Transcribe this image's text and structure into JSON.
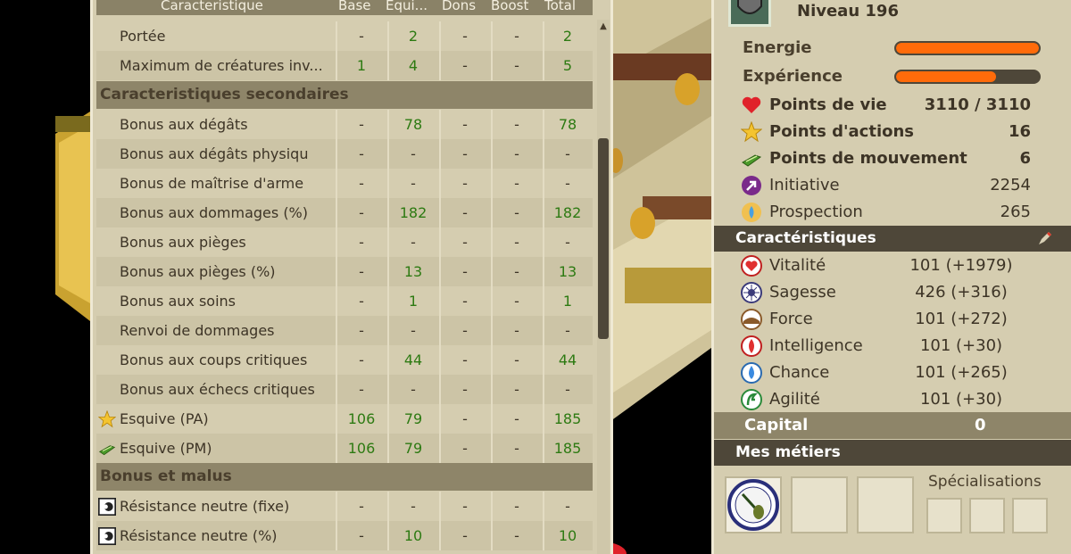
{
  "stats_table": {
    "headers": {
      "name": "Caracteristique",
      "base": "Base",
      "equip": "Equi...",
      "dons": "Dons",
      "boost": "Boost",
      "total": "Total"
    },
    "rows_top": [
      {
        "name": "Portée",
        "base": "-",
        "equip": "2",
        "dons": "-",
        "boost": "-",
        "total": "2"
      },
      {
        "name": "Maximum de créatures inv...",
        "base": "1",
        "equip": "4",
        "dons": "-",
        "boost": "-",
        "total": "5"
      }
    ],
    "section_secondary": "Caracteristiques secondaires",
    "rows_secondary": [
      {
        "name": "Bonus aux dégâts",
        "base": "-",
        "equip": "78",
        "dons": "-",
        "boost": "-",
        "total": "78"
      },
      {
        "name": "Bonus aux dégâts physiqu",
        "base": "-",
        "equip": "-",
        "dons": "-",
        "boost": "-",
        "total": "-"
      },
      {
        "name": "Bonus de maîtrise d'arme",
        "base": "-",
        "equip": "-",
        "dons": "-",
        "boost": "-",
        "total": "-"
      },
      {
        "name": "Bonus aux dommages (%)",
        "base": "-",
        "equip": "182",
        "dons": "-",
        "boost": "-",
        "total": "182"
      },
      {
        "name": "Bonus aux pièges",
        "base": "-",
        "equip": "-",
        "dons": "-",
        "boost": "-",
        "total": "-"
      },
      {
        "name": "Bonus aux pièges (%)",
        "base": "-",
        "equip": "13",
        "dons": "-",
        "boost": "-",
        "total": "13"
      },
      {
        "name": "Bonus aux soins",
        "base": "-",
        "equip": "1",
        "dons": "-",
        "boost": "-",
        "total": "1"
      },
      {
        "name": "Renvoi de dommages",
        "base": "-",
        "equip": "-",
        "dons": "-",
        "boost": "-",
        "total": "-"
      },
      {
        "name": "Bonus aux coups critiques",
        "base": "-",
        "equip": "44",
        "dons": "-",
        "boost": "-",
        "total": "44"
      },
      {
        "name": "Bonus aux échecs critiques",
        "base": "-",
        "equip": "-",
        "dons": "-",
        "boost": "-",
        "total": "-"
      },
      {
        "name": "Esquive (PA)",
        "base": "106",
        "equip": "79",
        "dons": "-",
        "boost": "-",
        "total": "185",
        "icon": "star-icon"
      },
      {
        "name": "Esquive (PM)",
        "base": "106",
        "equip": "79",
        "dons": "-",
        "boost": "-",
        "total": "185",
        "icon": "movement-boot-icon"
      }
    ],
    "section_bonus": "Bonus et malus",
    "rows_bonus": [
      {
        "name": "Résistance neutre (fixe)",
        "base": "-",
        "equip": "-",
        "dons": "-",
        "boost": "-",
        "total": "-",
        "icon": "neutral-resistance-icon"
      },
      {
        "name": "Résistance neutre (%)",
        "base": "-",
        "equip": "10",
        "dons": "-",
        "boost": "-",
        "total": "10",
        "icon": "neutral-resistance-icon"
      }
    ]
  },
  "character": {
    "level": "Niveau 196",
    "energie_label": "Energie",
    "energie_fill": 1.0,
    "experience_label": "Expérience",
    "experience_fill": 0.7,
    "vitals": [
      {
        "label": "Points de vie",
        "value": "3110 / 3110",
        "icon": "heart-icon"
      },
      {
        "label": "Points d'actions",
        "value": "16",
        "icon": "star-icon"
      },
      {
        "label": "Points de mouvement",
        "value": "6",
        "icon": "movement-boot-icon"
      },
      {
        "label": "Initiative",
        "value": "2254",
        "icon": "initiative-icon"
      },
      {
        "label": "Prospection",
        "value": "265",
        "icon": "prospection-icon"
      }
    ],
    "carac_title": "Caractéristiques",
    "caracs": [
      {
        "label": "Vitalité",
        "value": "101 (+1979)",
        "icon": "vitality-icon"
      },
      {
        "label": "Sagesse",
        "value": "426 (+316)",
        "icon": "wisdom-icon"
      },
      {
        "label": "Force",
        "value": "101 (+272)",
        "icon": "strength-icon"
      },
      {
        "label": "Intelligence",
        "value": "101 (+30)",
        "icon": "intelligence-icon"
      },
      {
        "label": "Chance",
        "value": "101 (+265)",
        "icon": "chance-icon"
      },
      {
        "label": "Agilité",
        "value": "101 (+30)",
        "icon": "agility-icon"
      }
    ],
    "capital_label": "Capital",
    "capital_value": "0",
    "metiers_title": "Mes métiers",
    "specialisations_label": "Spécialisations"
  },
  "colors": {
    "panel_bg": "#d5cdb0",
    "section_bg": "#8e8569",
    "dark_header": "#4e4739",
    "bar_fill": "#ff6b0a",
    "value_green": "#2d7a12"
  }
}
